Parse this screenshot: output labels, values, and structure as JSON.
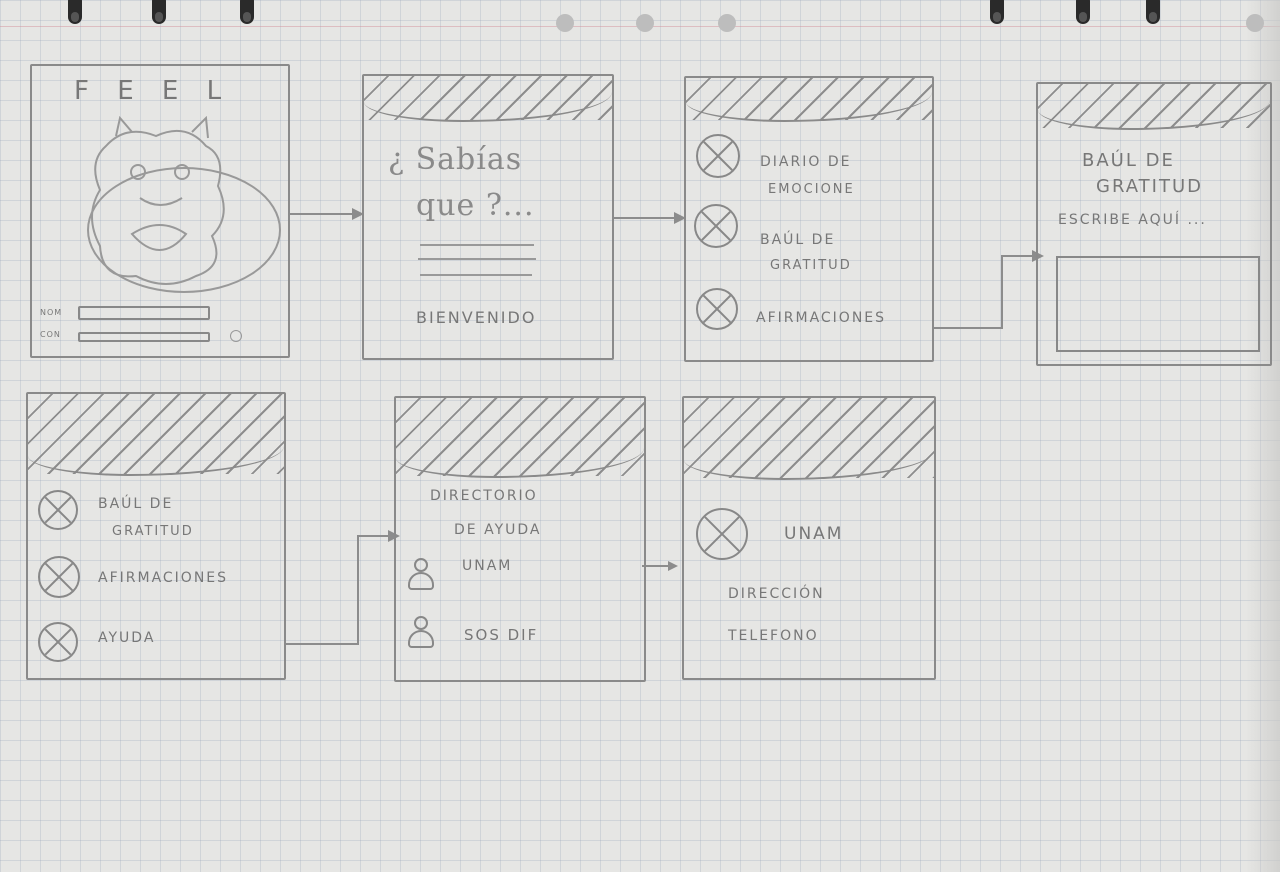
{
  "screens": {
    "login": {
      "title": "F E E L",
      "name_label": "NOM",
      "password_label": "CON"
    },
    "did_you_know": {
      "heading_line1": "¿ Sabías",
      "heading_line2": "que ?...",
      "welcome": "BIENVENIDO"
    },
    "menu_main": {
      "item1_line1": "DIARIO DE",
      "item1_line2": "EMOCIONE",
      "item2_line1": "BAÚL DE",
      "item2_line2": "GRATITUD",
      "item3": "AFIRMACIONES"
    },
    "gratitude": {
      "title_line1": "BAÚL DE",
      "title_line2": "GRATITUD",
      "prompt": "ESCRIBE AQUÍ ..."
    },
    "menu_help": {
      "item1_line1": "BAÚL DE",
      "item1_line2": "GRATITUD",
      "item2": "AFIRMACIONES",
      "item3": "AYUDA"
    },
    "directory": {
      "title_line1": "DIRECTORIO",
      "title_line2": "DE AYUDA",
      "contact1": "UNAM",
      "contact2": "SOS DIF"
    },
    "contact_detail": {
      "name": "UNAM",
      "address": "DIRECCIÓN",
      "phone": "TELEFONO"
    }
  }
}
